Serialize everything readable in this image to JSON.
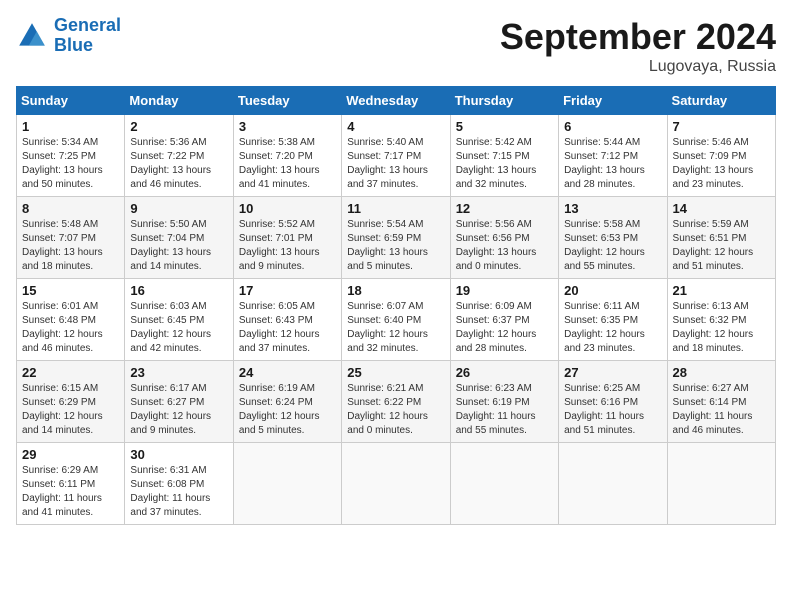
{
  "header": {
    "logo_line1": "General",
    "logo_line2": "Blue",
    "month_title": "September 2024",
    "location": "Lugovaya, Russia"
  },
  "calendar": {
    "days_of_week": [
      "Sunday",
      "Monday",
      "Tuesday",
      "Wednesday",
      "Thursday",
      "Friday",
      "Saturday"
    ],
    "weeks": [
      [
        {
          "day": "",
          "info": ""
        },
        {
          "day": "2",
          "info": "Sunrise: 5:36 AM\nSunset: 7:22 PM\nDaylight: 13 hours\nand 46 minutes."
        },
        {
          "day": "3",
          "info": "Sunrise: 5:38 AM\nSunset: 7:20 PM\nDaylight: 13 hours\nand 41 minutes."
        },
        {
          "day": "4",
          "info": "Sunrise: 5:40 AM\nSunset: 7:17 PM\nDaylight: 13 hours\nand 37 minutes."
        },
        {
          "day": "5",
          "info": "Sunrise: 5:42 AM\nSunset: 7:15 PM\nDaylight: 13 hours\nand 32 minutes."
        },
        {
          "day": "6",
          "info": "Sunrise: 5:44 AM\nSunset: 7:12 PM\nDaylight: 13 hours\nand 28 minutes."
        },
        {
          "day": "7",
          "info": "Sunrise: 5:46 AM\nSunset: 7:09 PM\nDaylight: 13 hours\nand 23 minutes."
        }
      ],
      [
        {
          "day": "1",
          "info": "Sunrise: 5:34 AM\nSunset: 7:25 PM\nDaylight: 13 hours\nand 50 minutes."
        },
        {
          "day": "9",
          "info": "Sunrise: 5:50 AM\nSunset: 7:04 PM\nDaylight: 13 hours\nand 14 minutes."
        },
        {
          "day": "10",
          "info": "Sunrise: 5:52 AM\nSunset: 7:01 PM\nDaylight: 13 hours\nand 9 minutes."
        },
        {
          "day": "11",
          "info": "Sunrise: 5:54 AM\nSunset: 6:59 PM\nDaylight: 13 hours\nand 5 minutes."
        },
        {
          "day": "12",
          "info": "Sunrise: 5:56 AM\nSunset: 6:56 PM\nDaylight: 13 hours\nand 0 minutes."
        },
        {
          "day": "13",
          "info": "Sunrise: 5:58 AM\nSunset: 6:53 PM\nDaylight: 12 hours\nand 55 minutes."
        },
        {
          "day": "14",
          "info": "Sunrise: 5:59 AM\nSunset: 6:51 PM\nDaylight: 12 hours\nand 51 minutes."
        }
      ],
      [
        {
          "day": "8",
          "info": "Sunrise: 5:48 AM\nSunset: 7:07 PM\nDaylight: 13 hours\nand 18 minutes."
        },
        {
          "day": "16",
          "info": "Sunrise: 6:03 AM\nSunset: 6:45 PM\nDaylight: 12 hours\nand 42 minutes."
        },
        {
          "day": "17",
          "info": "Sunrise: 6:05 AM\nSunset: 6:43 PM\nDaylight: 12 hours\nand 37 minutes."
        },
        {
          "day": "18",
          "info": "Sunrise: 6:07 AM\nSunset: 6:40 PM\nDaylight: 12 hours\nand 32 minutes."
        },
        {
          "day": "19",
          "info": "Sunrise: 6:09 AM\nSunset: 6:37 PM\nDaylight: 12 hours\nand 28 minutes."
        },
        {
          "day": "20",
          "info": "Sunrise: 6:11 AM\nSunset: 6:35 PM\nDaylight: 12 hours\nand 23 minutes."
        },
        {
          "day": "21",
          "info": "Sunrise: 6:13 AM\nSunset: 6:32 PM\nDaylight: 12 hours\nand 18 minutes."
        }
      ],
      [
        {
          "day": "15",
          "info": "Sunrise: 6:01 AM\nSunset: 6:48 PM\nDaylight: 12 hours\nand 46 minutes."
        },
        {
          "day": "23",
          "info": "Sunrise: 6:17 AM\nSunset: 6:27 PM\nDaylight: 12 hours\nand 9 minutes."
        },
        {
          "day": "24",
          "info": "Sunrise: 6:19 AM\nSunset: 6:24 PM\nDaylight: 12 hours\nand 5 minutes."
        },
        {
          "day": "25",
          "info": "Sunrise: 6:21 AM\nSunset: 6:22 PM\nDaylight: 12 hours\nand 0 minutes."
        },
        {
          "day": "26",
          "info": "Sunrise: 6:23 AM\nSunset: 6:19 PM\nDaylight: 11 hours\nand 55 minutes."
        },
        {
          "day": "27",
          "info": "Sunrise: 6:25 AM\nSunset: 6:16 PM\nDaylight: 11 hours\nand 51 minutes."
        },
        {
          "day": "28",
          "info": "Sunrise: 6:27 AM\nSunset: 6:14 PM\nDaylight: 11 hours\nand 46 minutes."
        }
      ],
      [
        {
          "day": "22",
          "info": "Sunrise: 6:15 AM\nSunset: 6:29 PM\nDaylight: 12 hours\nand 14 minutes."
        },
        {
          "day": "30",
          "info": "Sunrise: 6:31 AM\nSunset: 6:08 PM\nDaylight: 11 hours\nand 37 minutes."
        },
        {
          "day": "",
          "info": ""
        },
        {
          "day": "",
          "info": ""
        },
        {
          "day": "",
          "info": ""
        },
        {
          "day": "",
          "info": ""
        },
        {
          "day": ""
        }
      ],
      [
        {
          "day": "29",
          "info": "Sunrise: 6:29 AM\nSunset: 6:11 PM\nDaylight: 11 hours\nand 41 minutes."
        },
        {
          "day": "",
          "info": ""
        },
        {
          "day": "",
          "info": ""
        },
        {
          "day": "",
          "info": ""
        },
        {
          "day": "",
          "info": ""
        },
        {
          "day": "",
          "info": ""
        },
        {
          "day": "",
          "info": ""
        }
      ]
    ]
  }
}
